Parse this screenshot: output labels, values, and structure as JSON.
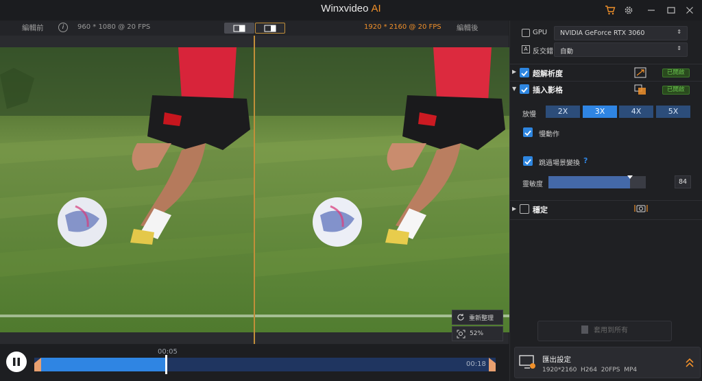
{
  "app": {
    "title": "Winxvideo",
    "title_accent": "AI"
  },
  "compare": {
    "before_label": "編輯前",
    "before_info": "960 * 1080 @ 20 FPS",
    "after_info": "1920 * 2160 @ 20 FPS",
    "after_label": "編輯後"
  },
  "overlay": {
    "reset_label": "重新整理",
    "zoom_label": "52%"
  },
  "timeline": {
    "current_time": "00:05",
    "end_time": "00:18",
    "progress": 0.32
  },
  "settings": {
    "gpu_label": "GPU",
    "gpu_value": "NVIDIA GeForce RTX 3060",
    "aa_label": "反交錯",
    "aa_value": "自動",
    "sections": {
      "super_res": {
        "label": "超解析度",
        "status": "已開啟"
      },
      "frame_interp": {
        "label": "插入影格",
        "status": "已開啟"
      },
      "stabilize": {
        "label": "穩定"
      }
    },
    "slowmo_label": "放慢",
    "multipliers": [
      "2X",
      "3X",
      "4X",
      "5X"
    ],
    "active_multiplier": "3X",
    "motion_label": "慢動作",
    "scene_skip_label": "跳過場景變換",
    "help_mark": "?",
    "sensitivity_label": "靈敏度",
    "sensitivity_value": "84",
    "apply_all_label": "套用到所有"
  },
  "export": {
    "title": "匯出設定",
    "details": "1920*2160  H264  20FPS  MP4"
  },
  "colors": {
    "accent": "#2f85e3",
    "orange": "#f0902a",
    "green": "#69c24e"
  }
}
